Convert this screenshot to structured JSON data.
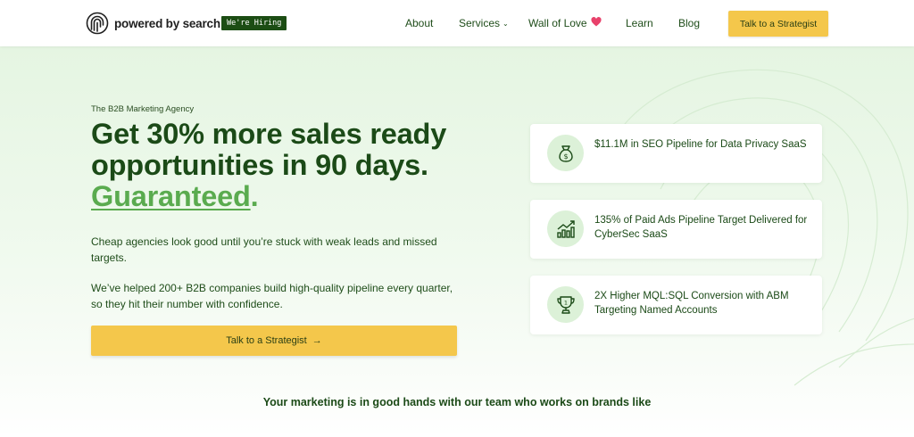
{
  "header": {
    "logo_text": "powered by search",
    "hiring_badge": "We're Hiring",
    "nav": {
      "about": "About",
      "services": "Services",
      "wall_of_love": "Wall of Love",
      "learn": "Learn",
      "blog": "Blog"
    },
    "cta": "Talk to a Strategist"
  },
  "hero": {
    "eyebrow": "The B2B Marketing Agency",
    "headline_main": "Get 30% more sales ready opportunities in 90 days.",
    "headline_accent": "Guaranteed",
    "headline_period": ".",
    "paragraph_1": "Cheap agencies look good until you’re stuck with weak leads and missed targets.",
    "paragraph_2": "We’ve helped 200+ B2B companies build high-quality pipeline every quarter, so they hit their number with confidence.",
    "cta": "Talk to a Strategist",
    "cta_arrow": "→"
  },
  "stats": [
    {
      "icon": "money-bag-icon",
      "text": "$11.1M in SEO Pipeline for Data Privacy SaaS"
    },
    {
      "icon": "growth-chart-icon",
      "text": "135% of Paid Ads Pipeline Target Delivered for CyberSec SaaS"
    },
    {
      "icon": "trophy-icon",
      "text": "2X Higher MQL:SQL Conversion with ABM Targeting Named Accounts"
    }
  ],
  "brands_heading": "Your marketing is in good hands with our team who works on brands like",
  "colors": {
    "brand_green": "#1b4a17",
    "accent_green": "#5aab4f",
    "cta_yellow": "#f4c74b",
    "badge_green": "#1c4d14",
    "heart_pink": "#e8416b"
  }
}
